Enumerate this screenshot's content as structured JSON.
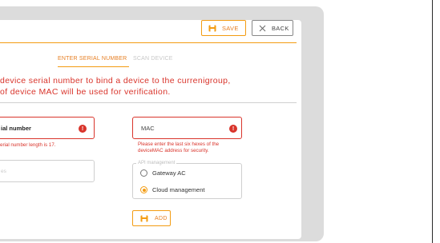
{
  "toolbar": {
    "save_label": "SAVE",
    "back_label": "BACK"
  },
  "tabs": [
    {
      "label": "ENTER SERIAL NUMBER",
      "active": true
    },
    {
      "label": "SCAN DEVICE",
      "active": false
    }
  ],
  "instructions": {
    "line1": "device serial number to bind a device to the currenigroup,",
    "line2": "of device MAC will be used for verification."
  },
  "form": {
    "serial": {
      "value": "ial number",
      "error": "erial number length is 17."
    },
    "mac": {
      "value": "MAC",
      "error_line1": "Please enter the last six hexes of the",
      "error_line2": "deviceMAC address for security."
    },
    "notes": {
      "placeholder": "es"
    },
    "api_management": {
      "legend": "API management",
      "options": [
        {
          "label": "Gateway AC",
          "selected": false
        },
        {
          "label": "Cloud management",
          "selected": true
        }
      ]
    },
    "add_label": "ADD"
  },
  "colors": {
    "accent": "#f39c12",
    "error": "#d9342b",
    "frame": "#dcdcdc"
  }
}
